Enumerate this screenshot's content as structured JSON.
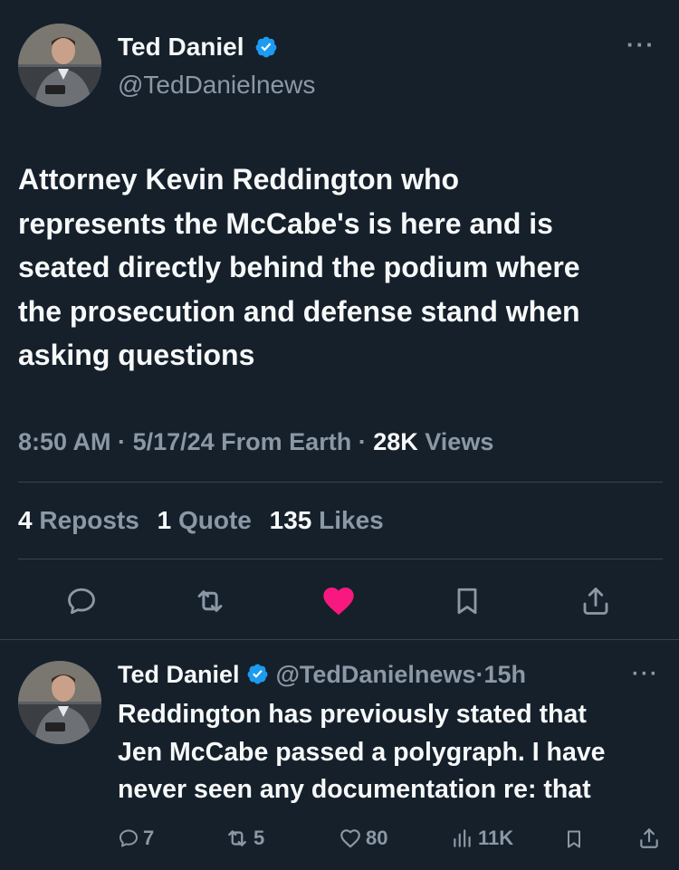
{
  "main_tweet": {
    "author_name": "Ted Daniel",
    "handle": "@TedDanielnews",
    "more": "···",
    "text_lines": [
      "Attorney Kevin Reddington who",
      "represents the McCabe's is here and is",
      "seated directly behind the podium where",
      "the prosecution and defense stand when",
      "asking questions"
    ],
    "time": "8:50 AM",
    "sep1": "·",
    "date": "5/17/24",
    "source": "From Earth",
    "sep2": "·",
    "views_count": "28K",
    "views_label": "Views",
    "stats": {
      "reposts_count": "4",
      "reposts_label": "Reposts",
      "quotes_count": "1",
      "quotes_label": "Quote",
      "likes_count": "135",
      "likes_label": "Likes"
    },
    "actions": [
      "reply-icon",
      "repost-icon",
      "like-icon-filled",
      "bookmark-icon",
      "share-icon"
    ],
    "like_color": "#f91880"
  },
  "reply_tweet": {
    "author_name": "Ted Daniel",
    "handle": "@TedDanielnews",
    "sep": "·",
    "time": "15h",
    "more": "···",
    "text_lines": [
      "Reddington has previously stated that",
      "Jen McCabe passed a polygraph. I have",
      "never seen any documentation re: that"
    ],
    "actions": {
      "replies": "7",
      "reposts": "5",
      "likes": "80",
      "views": "11K"
    }
  },
  "colors": {
    "background": "#15202b",
    "text": "#f7f9f9",
    "secondary": "#8b98a5",
    "verified": "#1d9bf0",
    "divider": "#38444d"
  }
}
